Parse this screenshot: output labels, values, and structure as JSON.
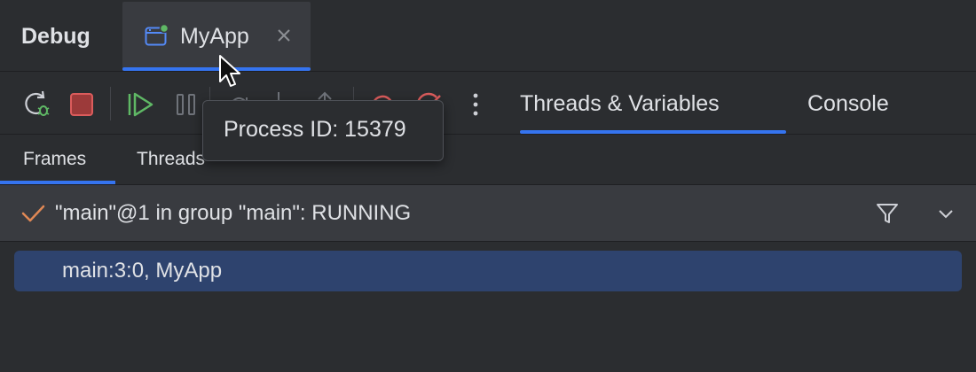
{
  "header": {
    "title": "Debug",
    "session_tab": {
      "label": "MyApp",
      "icon": "application-window-icon",
      "status_color": "#5fb865"
    }
  },
  "toolbar": {
    "buttons": [
      {
        "name": "rerun-debug-icon",
        "tooltip": ""
      },
      {
        "name": "stop-icon",
        "color": "#c94f4f"
      },
      {
        "name": "resume-program-icon",
        "color": "#5fb865"
      },
      {
        "name": "pause-icon"
      },
      {
        "name": "step-over-icon"
      },
      {
        "name": "step-into-icon"
      },
      {
        "name": "step-out-icon"
      },
      {
        "name": "view-breakpoints-icon",
        "color": "#c94f4f"
      },
      {
        "name": "mute-breakpoints-icon",
        "color": "#c94f4f"
      },
      {
        "name": "more-actions-icon"
      }
    ],
    "tabs": [
      {
        "label": "Threads & Variables",
        "active": true
      },
      {
        "label": "Console",
        "active": false
      }
    ]
  },
  "tooltip": {
    "text": "Process ID: 15379"
  },
  "frames_panel": {
    "tabs": [
      {
        "label": "Frames",
        "active": true
      },
      {
        "label": "Threads",
        "active": false
      }
    ],
    "thread_selector": {
      "label": "\"main\"@1 in group \"main\": RUNNING",
      "status_icon": "check-icon"
    },
    "frames": [
      {
        "label": "main:3:0, MyApp",
        "selected": true
      }
    ]
  },
  "colors": {
    "background": "#2b2d30",
    "accent": "#3574f0",
    "selection": "#2e436e",
    "tab_active": "#393b40"
  }
}
